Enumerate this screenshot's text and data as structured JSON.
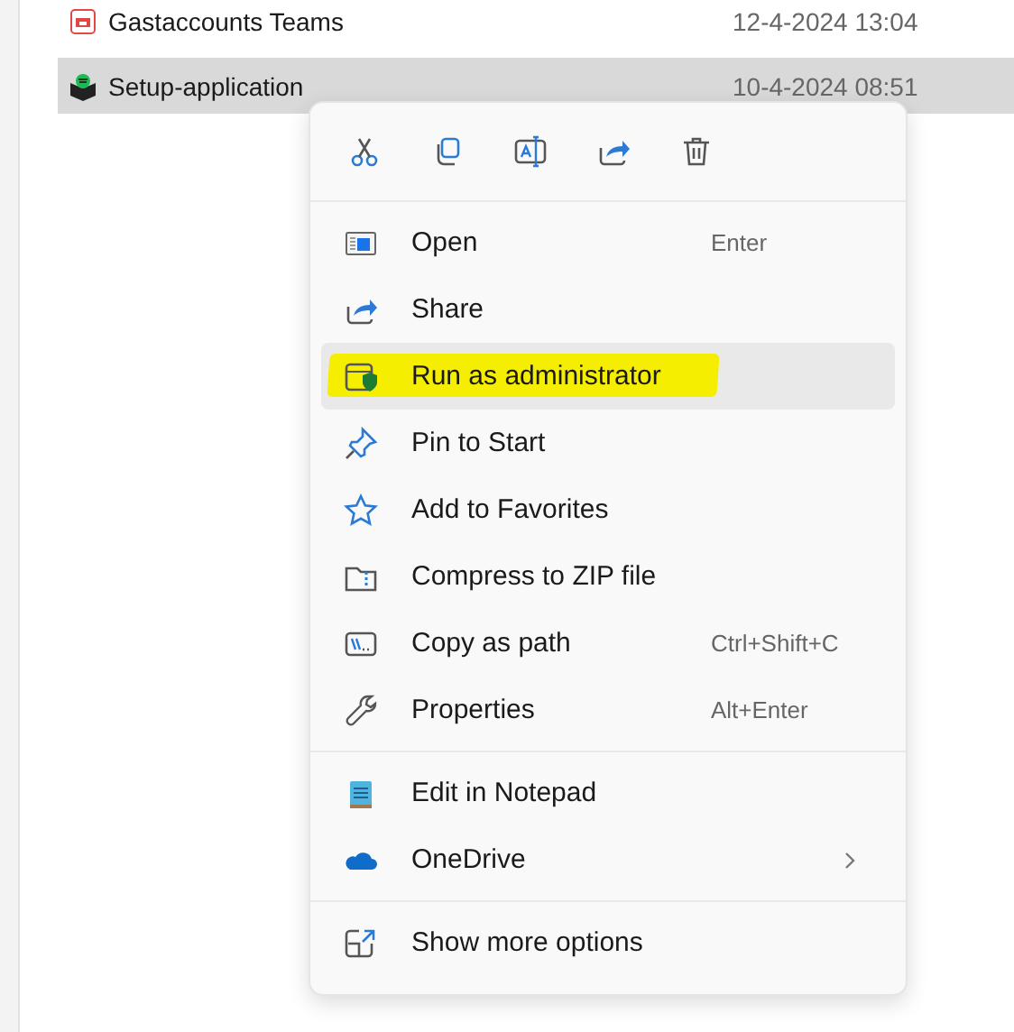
{
  "files": [
    {
      "name": "Gastaccounts Teams",
      "date": "12-4-2024 13:04",
      "kind": "teams",
      "selected": false
    },
    {
      "name": "Setup-application",
      "date": "10-4-2024 08:51",
      "kind": "setup",
      "selected": true
    }
  ],
  "context_menu": {
    "toolbar": [
      {
        "kind": "cut"
      },
      {
        "kind": "copy"
      },
      {
        "kind": "rename"
      },
      {
        "kind": "share"
      },
      {
        "kind": "delete"
      }
    ],
    "sections": [
      {
        "items": [
          {
            "label": "Open",
            "shortcut": "Enter",
            "kind": "open",
            "selected": false,
            "marked": false,
            "submenu": false
          },
          {
            "label": "Share",
            "kind": "share",
            "selected": false,
            "marked": false,
            "submenu": false
          },
          {
            "label": "Run as administrator",
            "kind": "admin",
            "selected": true,
            "marked": true,
            "submenu": false
          },
          {
            "label": "Pin to Start",
            "kind": "pin",
            "selected": false,
            "marked": false,
            "submenu": false
          },
          {
            "label": "Add to Favorites",
            "kind": "star",
            "selected": false,
            "marked": false,
            "submenu": false
          },
          {
            "label": "Compress to ZIP file",
            "kind": "zip",
            "selected": false,
            "marked": false,
            "submenu": false
          },
          {
            "label": "Copy as path",
            "shortcut": "Ctrl+Shift+C",
            "kind": "path",
            "selected": false,
            "marked": false,
            "submenu": false
          },
          {
            "label": "Properties",
            "shortcut": "Alt+Enter",
            "kind": "wrench",
            "selected": false,
            "marked": false,
            "submenu": false
          }
        ]
      },
      {
        "items": [
          {
            "label": "Edit in Notepad",
            "kind": "notepad",
            "selected": false,
            "marked": false,
            "submenu": false
          },
          {
            "label": "OneDrive",
            "kind": "cloud",
            "selected": false,
            "marked": false,
            "submenu": true
          }
        ]
      },
      {
        "items": [
          {
            "label": "Show more options",
            "kind": "more",
            "selected": false,
            "marked": false,
            "submenu": false
          }
        ]
      }
    ]
  }
}
